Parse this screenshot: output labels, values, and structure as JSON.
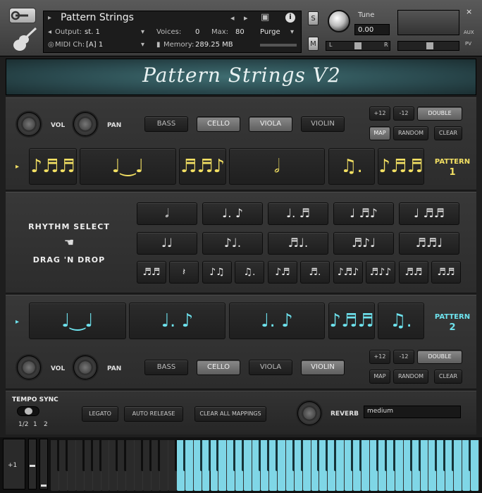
{
  "header": {
    "instrument_name": "Pattern Strings",
    "output_label": "Output:",
    "output_value": "st. 1",
    "voices_label": "Voices:",
    "voices_value": "0",
    "max_label": "Max:",
    "max_value": "80",
    "purge_label": "Purge",
    "midi_label": "MIDI Ch:",
    "midi_value": "[A] 1",
    "memory_label": "Memory:",
    "memory_value": "289.25 MB",
    "s_label": "S",
    "m_label": "M",
    "tune_label": "Tune",
    "tune_value": "0.00",
    "pan_left": "L",
    "pan_right": "R",
    "close_label": "×",
    "aux_label": "AUX",
    "pv_label": "PV"
  },
  "banner": {
    "title": "Pattern Strings V2"
  },
  "top_section": {
    "vol_label": "VOL",
    "pan_label": "PAN",
    "instruments": [
      {
        "label": "BASS",
        "active": false
      },
      {
        "label": "CELLO",
        "active": true
      },
      {
        "label": "VIOLA",
        "active": true
      },
      {
        "label": "VIOLIN",
        "active": false
      }
    ],
    "plus12": "+12",
    "minus12": "-12",
    "double": "DOUBLE",
    "map": "MAP",
    "random": "RANDOM",
    "clear": "CLEAR",
    "pattern_label": "PATTERN",
    "pattern_number": "1",
    "arrow": "▸",
    "slots": [
      "♪♬♬",
      "♩‿♩",
      "♬♬♪",
      "𝅗𝅥",
      "♫.",
      "♪♬♬"
    ]
  },
  "rhythm_select": {
    "title": "RHYTHM SELECT",
    "subtitle": "DRAG 'N DROP",
    "hand_icon": "☚",
    "row1": [
      "𝅗𝅥",
      "♩. ♪",
      "♩. ♬",
      "♩ ♬♪",
      "♩ ♬♬"
    ],
    "row2": [
      "♩♩",
      "♪♩.",
      "♬♩.",
      "♬♪♩",
      "♬♬♩"
    ],
    "row3": [
      "♬♬",
      "𝄽",
      "♪♫",
      "♫.",
      "♪♬",
      "♬.",
      "♪♬♪",
      "♬♪♪",
      "♬♬",
      "♬♬"
    ]
  },
  "bottom_section": {
    "vol_label": "VOL",
    "pan_label": "PAN",
    "instruments": [
      {
        "label": "BASS",
        "active": false
      },
      {
        "label": "CELLO",
        "active": true
      },
      {
        "label": "VIOLA",
        "active": false
      },
      {
        "label": "VIOLIN",
        "active": true
      }
    ],
    "plus12": "+12",
    "minus12": "-12",
    "double": "DOUBLE",
    "map": "MAP",
    "random": "RANDOM",
    "clear": "CLEAR",
    "pattern_label": "PATTERN",
    "pattern_number": "2",
    "arrow": "▸",
    "slots": [
      "♩‿♩",
      "♩. ♪",
      "♩. ♪",
      "♪♬♬",
      "♫."
    ]
  },
  "footer": {
    "tempo_sync_label": "TEMPO SYNC",
    "sync_options": [
      "1/2",
      "1",
      "2"
    ],
    "legato": "LEGATO",
    "auto_release": "AUTO RELEASE",
    "clear_all": "CLEAR ALL MAPPINGS",
    "reverb_label": "REVERB",
    "reverb_value": "medium"
  },
  "keyboard": {
    "octave_label": "+1",
    "highlight_color": "#7fd6e6"
  },
  "colors": {
    "pattern1": "#f3e063",
    "pattern2": "#6ee3ee",
    "banner": "#2f5457"
  }
}
